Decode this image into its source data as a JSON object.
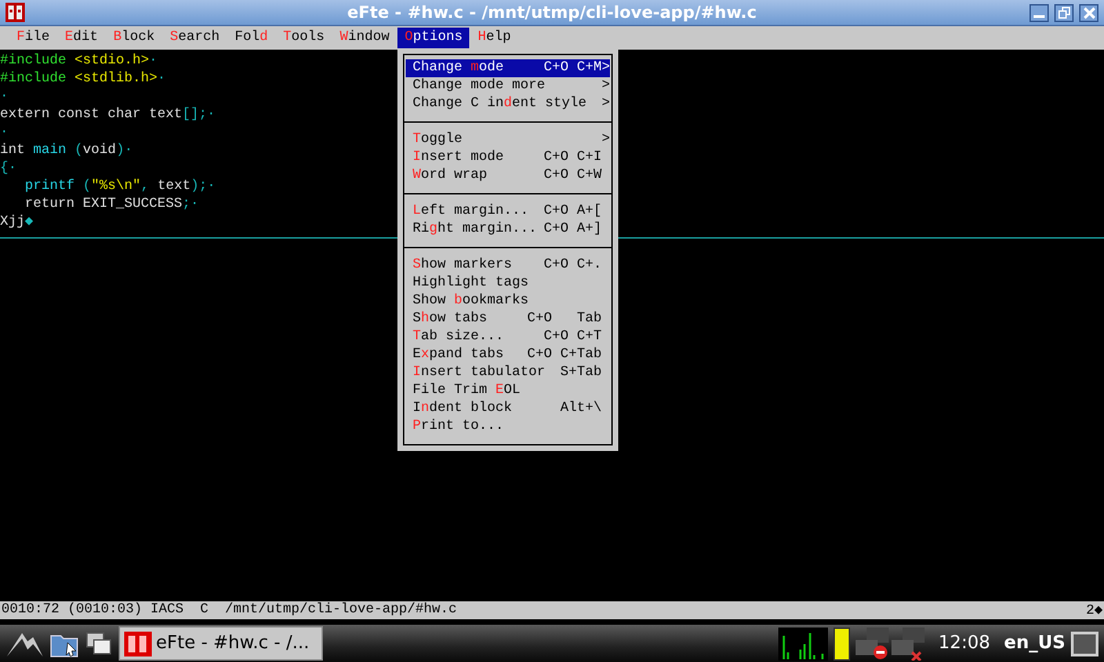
{
  "window": {
    "title": "eFte - #hw.c - /mnt/utmp/cli-love-app/#hw.c"
  },
  "menubar": [
    {
      "key": "F",
      "after": "ile",
      "selected": false
    },
    {
      "key": "E",
      "after": "dit",
      "selected": false
    },
    {
      "key": "B",
      "after": "lock",
      "selected": false
    },
    {
      "key": "S",
      "after": "earch",
      "selected": false
    },
    {
      "before": "Fol",
      "key": "d",
      "selected": false
    },
    {
      "key": "T",
      "after": "ools",
      "selected": false
    },
    {
      "key": "W",
      "after": "indow",
      "selected": false
    },
    {
      "key": "O",
      "after": "ptions",
      "selected": true
    },
    {
      "key": "H",
      "after": "elp",
      "selected": false
    }
  ],
  "editor": {
    "lines": [
      [
        {
          "kind": "preproc",
          "text": "#include "
        },
        {
          "kind": "string",
          "text": "<stdio.h>"
        },
        {
          "kind": "eol",
          "text": "·"
        }
      ],
      [
        {
          "kind": "preproc",
          "text": "#include "
        },
        {
          "kind": "string",
          "text": "<stdlib.h>"
        },
        {
          "kind": "eol",
          "text": "·"
        }
      ],
      [
        {
          "kind": "eol",
          "text": "·"
        }
      ],
      [
        {
          "kind": "plain",
          "text": "extern const char text"
        },
        {
          "kind": "punct",
          "text": "[];"
        },
        {
          "kind": "eol",
          "text": "·"
        }
      ],
      [
        {
          "kind": "eol",
          "text": "·"
        }
      ],
      [
        {
          "kind": "plain",
          "text": "int "
        },
        {
          "kind": "func",
          "text": "main"
        },
        {
          "kind": "punct",
          "text": " ("
        },
        {
          "kind": "plain",
          "text": "void"
        },
        {
          "kind": "punct",
          "text": ")"
        },
        {
          "kind": "eol",
          "text": "·"
        }
      ],
      [
        {
          "kind": "punct",
          "text": "{"
        },
        {
          "kind": "eol",
          "text": "·"
        }
      ],
      [
        {
          "kind": "func",
          "text": "   printf"
        },
        {
          "kind": "punct",
          "text": " ("
        },
        {
          "kind": "string",
          "text": "\"%s\\n\""
        },
        {
          "kind": "punct",
          "text": ", "
        },
        {
          "kind": "plain",
          "text": "text"
        },
        {
          "kind": "punct",
          "text": ");"
        },
        {
          "kind": "eol",
          "text": "·"
        }
      ],
      [
        {
          "kind": "plain",
          "text": "   return EXIT_SUCCESS"
        },
        {
          "kind": "punct",
          "text": ";"
        },
        {
          "kind": "eol",
          "text": "·"
        }
      ],
      [
        {
          "kind": "plain",
          "text": "Xjj"
        },
        {
          "kind": "eol",
          "text": "◆"
        }
      ]
    ]
  },
  "options_menu": [
    {
      "kind": "item",
      "before": "Change ",
      "key": "m",
      "after": "ode",
      "shortcut": "C+O C+M",
      "arrow": ">",
      "selected": true
    },
    {
      "kind": "item",
      "before": "Change mode more",
      "arrow": ">",
      "selected": false
    },
    {
      "kind": "item",
      "before": "Change C in",
      "key": "d",
      "after": "ent style",
      "arrow": ">",
      "selected": false
    },
    {
      "kind": "separator"
    },
    {
      "kind": "item",
      "key": "T",
      "after": "oggle",
      "arrow": ">",
      "selected": false
    },
    {
      "kind": "item",
      "key": "I",
      "after": "nsert mode",
      "shortcut": "C+O C+I",
      "selected": false
    },
    {
      "kind": "item",
      "key": "W",
      "after": "ord wrap",
      "shortcut": "C+O C+W",
      "selected": false
    },
    {
      "kind": "separator"
    },
    {
      "kind": "item",
      "key": "L",
      "after": "eft margin...",
      "shortcut": "C+O A+[",
      "selected": false
    },
    {
      "kind": "item",
      "before": "Ri",
      "key": "g",
      "after": "ht margin...",
      "shortcut": "C+O A+]",
      "selected": false
    },
    {
      "kind": "separator"
    },
    {
      "kind": "item",
      "key": "S",
      "after": "how markers",
      "shortcut": "C+O C+.",
      "selected": false
    },
    {
      "kind": "item",
      "before": "Highlight tags",
      "selected": false
    },
    {
      "kind": "item",
      "before": "Show ",
      "key": "b",
      "after": "ookmarks",
      "selected": false
    },
    {
      "kind": "item",
      "before": "S",
      "key": "h",
      "after": "ow tabs",
      "shortcut": "C+O   Tab",
      "selected": false
    },
    {
      "kind": "item",
      "key": "T",
      "after": "ab size...",
      "shortcut": "C+O C+T",
      "selected": false
    },
    {
      "kind": "item",
      "before": "E",
      "key": "x",
      "after": "pand tabs",
      "shortcut": "C+O C+Tab",
      "selected": false
    },
    {
      "kind": "item",
      "key": "I",
      "after": "nsert tabulator",
      "shortcut": "S+Tab",
      "selected": false
    },
    {
      "kind": "item",
      "before": "File Trim ",
      "key": "E",
      "after": "OL",
      "selected": false
    },
    {
      "kind": "item",
      "before": "I",
      "key": "n",
      "after": "dent block",
      "shortcut": "Alt+\\",
      "selected": false
    },
    {
      "kind": "item",
      "key": "P",
      "after": "rint to...",
      "selected": false
    }
  ],
  "status_line": {
    "left": "0010:72 (0010:03) IACS  C  /mnt/utmp/cli-love-app/#hw.c",
    "right": "2◆"
  },
  "taskbar": {
    "task": "eFte - #hw.c - /...",
    "clock": "12:08",
    "layout": "en_US"
  }
}
